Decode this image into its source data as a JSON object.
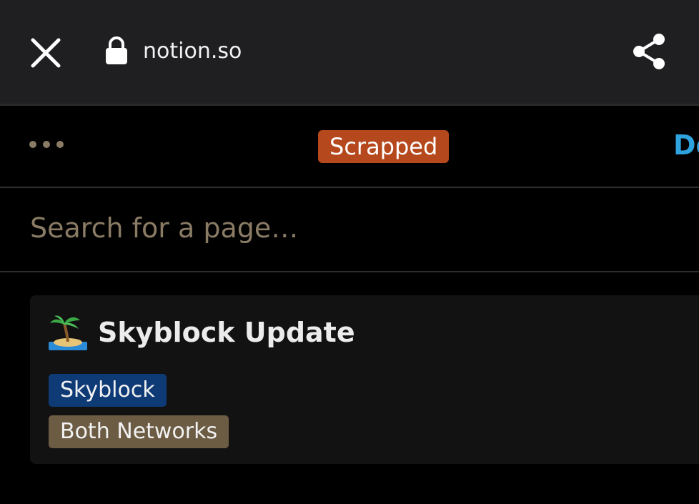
{
  "browser": {
    "url": "notion.so",
    "close_icon": "close-icon",
    "lock_icon": "lock-icon",
    "share_icon": "share-icon"
  },
  "toolbar": {
    "more_icon": "more-horizontal-icon",
    "status": "Scrapped",
    "status_color": "#b5481c",
    "done_label": "Do",
    "done_color": "#2ea3e0"
  },
  "search": {
    "placeholder": "Search for a page…",
    "value": ""
  },
  "page_card": {
    "emoji": "desert-island",
    "title": "Skyblock Update",
    "tags": [
      {
        "label": "Skyblock",
        "color": "#0e3a76"
      },
      {
        "label": "Both Networks",
        "color": "#6d5c44"
      }
    ]
  }
}
